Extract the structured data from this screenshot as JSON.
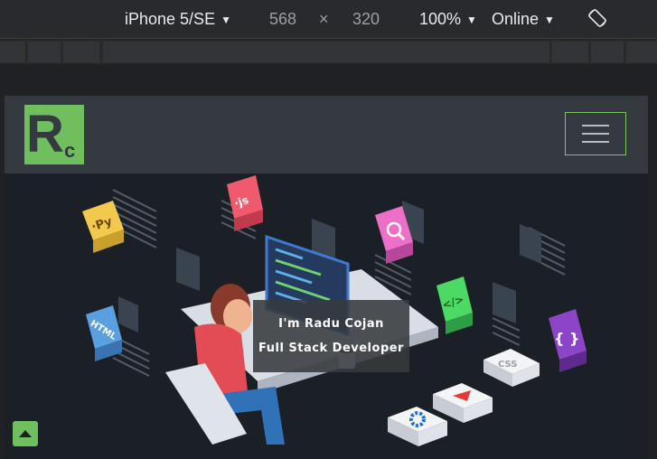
{
  "devtools": {
    "device": "iPhone 5/SE",
    "width": "568",
    "times": "×",
    "height": "320",
    "zoom": "100%",
    "network": "Online",
    "icons": {
      "dropdown": "caret-down-icon",
      "rotate": "rotate-icon"
    }
  },
  "site": {
    "logo_letters": {
      "big": "R",
      "small": "c"
    },
    "brand_color": "#6fbf5e",
    "navbar_color": "#343a40",
    "hero": {
      "line1": "I'm Radu Cojan",
      "line2": "Full Stack Developer",
      "cube_labels": {
        "python": "·Py",
        "js": "·js",
        "html": "HTML",
        "css": "CSS",
        "code": "</>",
        "braces": "{ }"
      }
    },
    "back_to_top_icon": "triangle-up-icon"
  }
}
